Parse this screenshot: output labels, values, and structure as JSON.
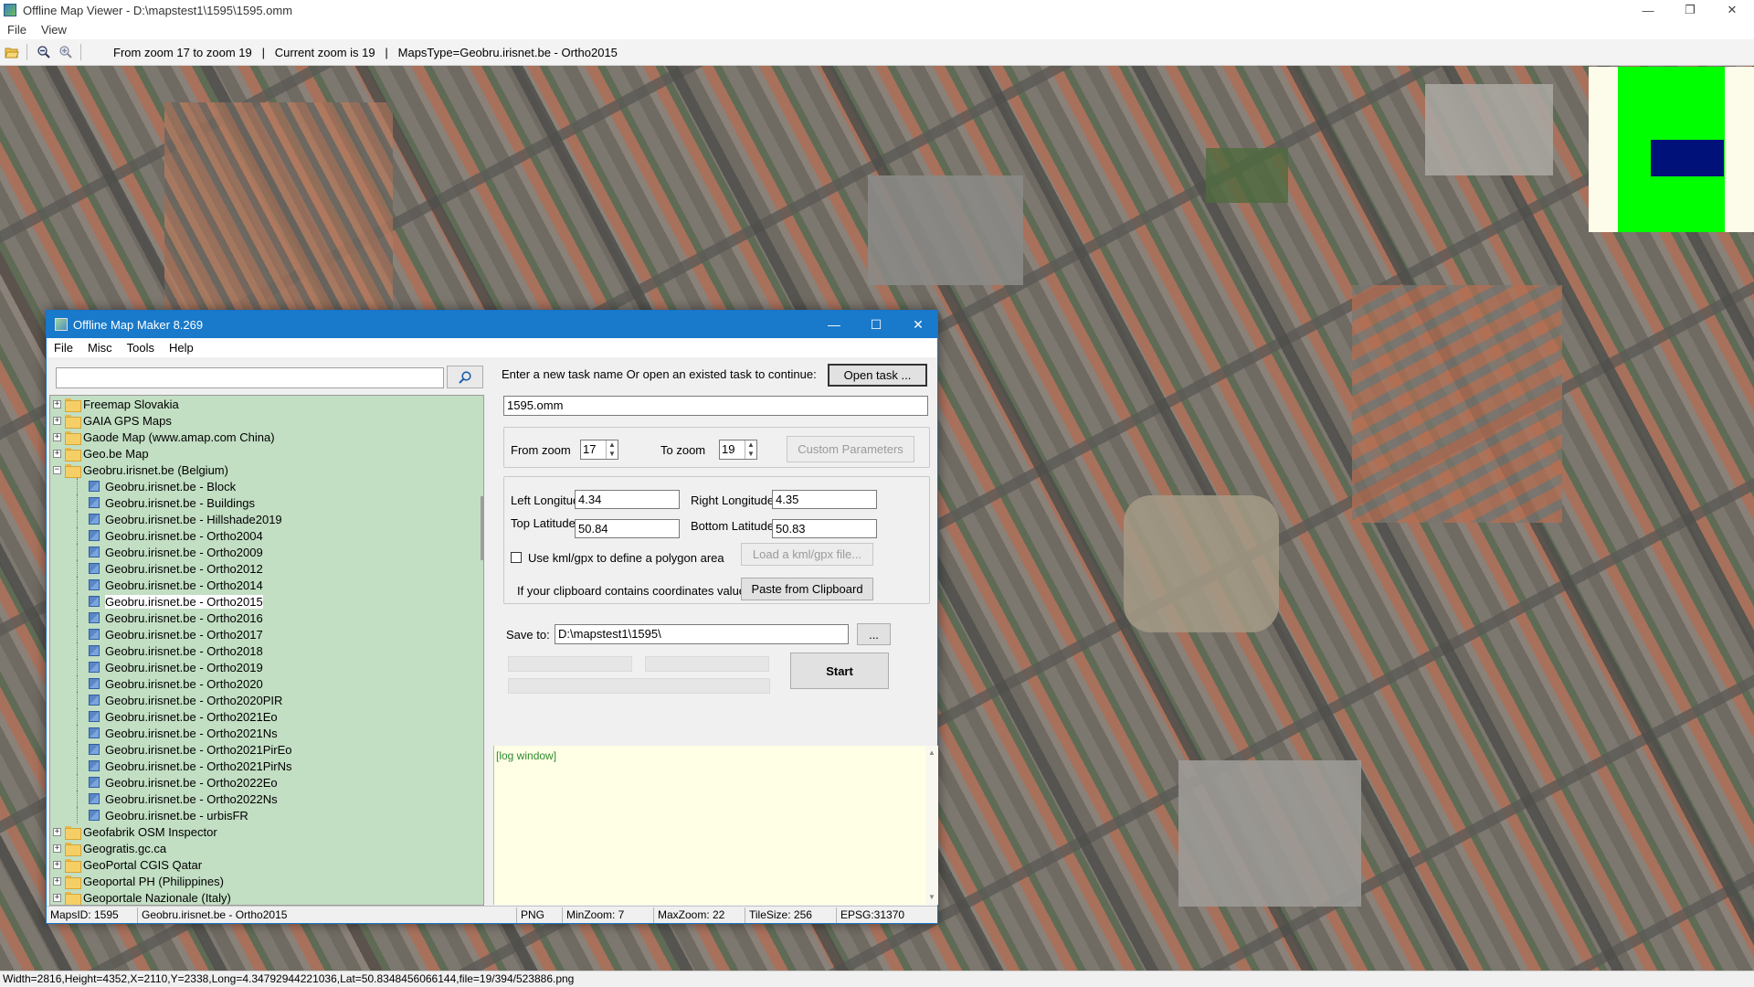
{
  "viewer": {
    "title": "Offline Map Viewer - D:\\mapstest1\\1595\\1595.omm",
    "window_controls": {
      "minimize": "—",
      "maximize": "❐",
      "close": "✕"
    },
    "menu": [
      "File",
      "View"
    ],
    "toolbar_status": "From zoom 17 to zoom 19   |   Current zoom is 19   |   MapsType=Geobru.irisnet.be - Ortho2015",
    "status_bar": "Width=2816,Height=4352,X=2110,Y=2338,Long=4.34792944221036,Lat=50.8348456066144,file=19/394/523886.png",
    "minimap_colors": {
      "background": "#fdfbe9",
      "coverage": "#00ff00",
      "viewport": "#00127a"
    }
  },
  "maker": {
    "title": "Offline Map Maker 8.269",
    "window_controls": {
      "minimize": "—",
      "maximize": "☐",
      "close": "✕"
    },
    "menu": [
      "File",
      "Misc",
      "Tools",
      "Help"
    ],
    "search": {
      "value": "",
      "placeholder": ""
    },
    "tree": {
      "top_nodes_before": [
        {
          "label": "Freemap Slovakia",
          "expander": "+"
        },
        {
          "label": "GAIA GPS Maps",
          "expander": "+"
        },
        {
          "label": "Gaode Map (www.amap.com China)",
          "expander": "+"
        },
        {
          "label": "Geo.be Map",
          "expander": "+"
        }
      ],
      "expanded_node": {
        "label": "Geobru.irisnet.be (Belgium)",
        "expander": "−"
      },
      "children": [
        "Geobru.irisnet.be - Block",
        "Geobru.irisnet.be - Buildings",
        "Geobru.irisnet.be - Hillshade2019",
        "Geobru.irisnet.be - Ortho2004",
        "Geobru.irisnet.be - Ortho2009",
        "Geobru.irisnet.be - Ortho2012",
        "Geobru.irisnet.be - Ortho2014",
        "Geobru.irisnet.be - Ortho2015",
        "Geobru.irisnet.be - Ortho2016",
        "Geobru.irisnet.be - Ortho2017",
        "Geobru.irisnet.be - Ortho2018",
        "Geobru.irisnet.be - Ortho2019",
        "Geobru.irisnet.be - Ortho2020",
        "Geobru.irisnet.be - Ortho2020PIR",
        "Geobru.irisnet.be - Ortho2021Eo",
        "Geobru.irisnet.be - Ortho2021Ns",
        "Geobru.irisnet.be - Ortho2021PirEo",
        "Geobru.irisnet.be - Ortho2021PirNs",
        "Geobru.irisnet.be - Ortho2022Eo",
        "Geobru.irisnet.be - Ortho2022Ns",
        "Geobru.irisnet.be - urbisFR"
      ],
      "selected_child": "Geobru.irisnet.be - Ortho2015",
      "top_nodes_after": [
        {
          "label": "Geofabrik OSM Inspector",
          "expander": "+"
        },
        {
          "label": "Geogratis.gc.ca",
          "expander": "+"
        },
        {
          "label": "GeoPortal CGIS Qatar",
          "expander": "+"
        },
        {
          "label": "Geoportal PH (Philippines)",
          "expander": "+"
        },
        {
          "label": "Geoportale Nazionale (Italy)",
          "expander": "+"
        }
      ]
    },
    "task": {
      "prompt": "Enter a new task name Or open an existed task to continue:",
      "open_button": "Open task ...",
      "name_value": "1595.omm"
    },
    "zoom": {
      "from_label": "From zoom",
      "from_value": "17",
      "to_label": "To zoom",
      "to_value": "19",
      "custom_button": "Custom Parameters"
    },
    "coords": {
      "left_lon_label": "Left Longitude",
      "left_lon_value": "4.34",
      "right_lon_label": "Right Longitude",
      "right_lon_value": "4.35",
      "top_lat_label": "Top Latitude",
      "top_lat_value": "50.84",
      "bottom_lat_label": "Bottom Latitude",
      "bottom_lat_value": "50.83",
      "kml_checkbox_label": "Use kml/gpx to define a polygon area",
      "kml_checked": false,
      "load_kml_button": "Load a kml/gpx file...",
      "clipboard_label": "If your clipboard contains coordinates values:",
      "paste_button": "Paste from Clipboard"
    },
    "save": {
      "label": "Save to:",
      "value": "D:\\mapstest1\\1595\\",
      "browse_button": "...",
      "start_button": "Start"
    },
    "log": {
      "text": "[log window]"
    },
    "status": {
      "maps_id": "MapsID: 1595",
      "map_name": "Geobru.irisnet.be - Ortho2015",
      "format": "PNG",
      "min_zoom": "MinZoom: 7",
      "max_zoom": "MaxZoom: 22",
      "tile_size": "TileSize: 256",
      "epsg": "EPSG:31370"
    }
  }
}
